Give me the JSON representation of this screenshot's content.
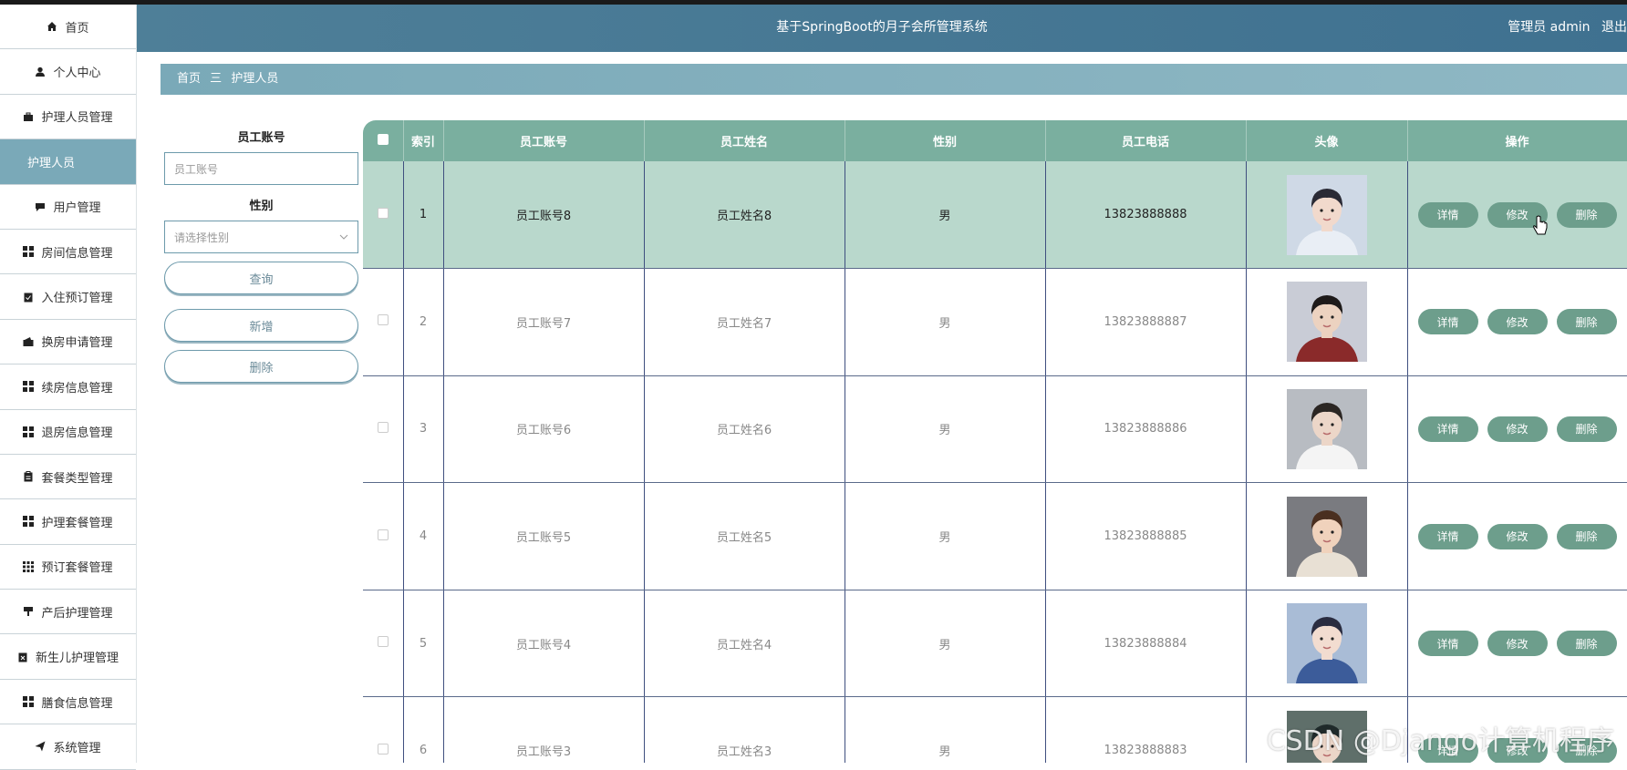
{
  "sidebar": {
    "items": [
      {
        "label": "首页",
        "icon": "home-icon",
        "active": false,
        "sub": false
      },
      {
        "label": "个人中心",
        "icon": "user-icon",
        "active": false,
        "sub": false
      },
      {
        "label": "护理人员管理",
        "icon": "briefcase-icon",
        "active": false,
        "sub": false
      },
      {
        "label": "护理人员",
        "icon": "",
        "active": true,
        "sub": true
      },
      {
        "label": "用户管理",
        "icon": "chat-icon",
        "active": false,
        "sub": false
      },
      {
        "label": "房间信息管理",
        "icon": "grid-icon",
        "active": false,
        "sub": false
      },
      {
        "label": "入住预订管理",
        "icon": "clipboard-check-icon",
        "active": false,
        "sub": false
      },
      {
        "label": "换房申请管理",
        "icon": "wallet-icon",
        "active": false,
        "sub": false
      },
      {
        "label": "续房信息管理",
        "icon": "grid-icon",
        "active": false,
        "sub": false
      },
      {
        "label": "退房信息管理",
        "icon": "grid-icon",
        "active": false,
        "sub": false
      },
      {
        "label": "套餐类型管理",
        "icon": "clipboard-icon",
        "active": false,
        "sub": false
      },
      {
        "label": "护理套餐管理",
        "icon": "grid-icon",
        "active": false,
        "sub": false
      },
      {
        "label": "预订套餐管理",
        "icon": "grid9-icon",
        "active": false,
        "sub": false
      },
      {
        "label": "产后护理管理",
        "icon": "brush-icon",
        "active": false,
        "sub": false
      },
      {
        "label": "新生儿护理管理",
        "icon": "clipboard-x-icon",
        "active": false,
        "sub": false
      },
      {
        "label": "膳食信息管理",
        "icon": "grid-icon",
        "active": false,
        "sub": false
      },
      {
        "label": "系统管理",
        "icon": "send-icon",
        "active": false,
        "sub": false
      }
    ]
  },
  "header": {
    "title": "基于SpringBoot的月子会所管理系统",
    "role": "管理员 admin",
    "logout": "退出"
  },
  "breadcrumb": {
    "home": "首页",
    "sep": "三",
    "current": "护理人员"
  },
  "filter": {
    "account_label": "员工账号",
    "account_placeholder": "员工账号",
    "gender_label": "性别",
    "gender_placeholder": "请选择性别",
    "query": "查询",
    "add": "新增",
    "delete": "删除"
  },
  "table": {
    "headers": [
      "索引",
      "员工账号",
      "员工姓名",
      "性别",
      "员工电话",
      "头像",
      "操作"
    ],
    "rows": [
      {
        "index": "1",
        "account": "员工账号8",
        "name": "员工姓名8",
        "gender": "男",
        "phone": "13823888888"
      },
      {
        "index": "2",
        "account": "员工账号7",
        "name": "员工姓名7",
        "gender": "男",
        "phone": "13823888887"
      },
      {
        "index": "3",
        "account": "员工账号6",
        "name": "员工姓名6",
        "gender": "男",
        "phone": "13823888886"
      },
      {
        "index": "4",
        "account": "员工账号5",
        "name": "员工姓名5",
        "gender": "男",
        "phone": "13823888885"
      },
      {
        "index": "5",
        "account": "员工账号4",
        "name": "员工姓名4",
        "gender": "男",
        "phone": "13823888884"
      },
      {
        "index": "6",
        "account": "员工账号3",
        "name": "员工姓名3",
        "gender": "男",
        "phone": "13823888883"
      }
    ],
    "actions": {
      "detail": "详情",
      "edit": "修改",
      "remove": "删除"
    }
  },
  "watermark": "CSDN @Django计算机程序",
  "colors": {
    "topbar": "#4e7f98",
    "active_menu": "#7aa9b8",
    "table_header": "#7aaf9f",
    "selected_row": "#b9d8cc",
    "action_button": "#6d9e8c"
  }
}
